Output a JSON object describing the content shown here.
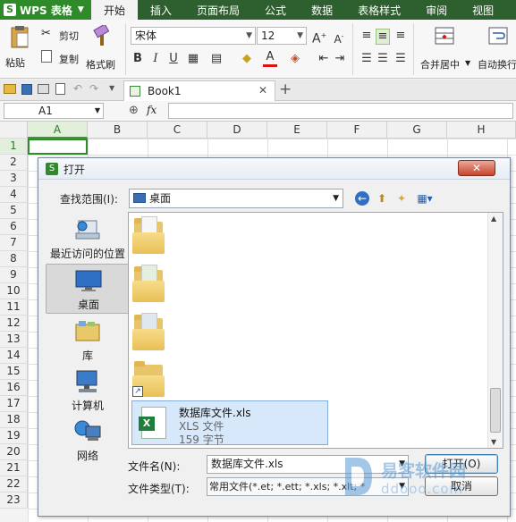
{
  "app": {
    "name": "WPS 表格"
  },
  "menu": [
    "开始",
    "插入",
    "页面布局",
    "公式",
    "数据",
    "表格样式",
    "审阅",
    "视图"
  ],
  "ribbon": {
    "paste": "粘贴",
    "cut": "剪切",
    "copy": "复制",
    "format_painter": "格式刷",
    "font_name": "宋体",
    "font_size": "12",
    "merge_center": "合并居中",
    "wrap_text": "自动换行"
  },
  "doc_tab": {
    "title": "Book1"
  },
  "formula_bar": {
    "cell_ref": "A1",
    "fx": "fx"
  },
  "grid": {
    "columns": [
      "A",
      "B",
      "C",
      "D",
      "E",
      "F",
      "G",
      "H"
    ],
    "rows": [
      "1",
      "2",
      "3",
      "4",
      "5",
      "6",
      "7",
      "8",
      "9",
      "10",
      "11",
      "12",
      "13",
      "14",
      "15",
      "16",
      "17",
      "18",
      "19",
      "20",
      "21",
      "22",
      "23"
    ]
  },
  "dialog": {
    "title": "打开",
    "close_label": "✕",
    "look_in_label": "查找范围(I):",
    "look_in_value": "桌面",
    "places": [
      {
        "label": "最近访问的位置",
        "icon": "recent-places-icon"
      },
      {
        "label": "桌面",
        "icon": "desktop-icon"
      },
      {
        "label": "库",
        "icon": "libraries-icon"
      },
      {
        "label": "计算机",
        "icon": "computer-icon"
      },
      {
        "label": "网络",
        "icon": "network-icon"
      }
    ],
    "file": {
      "name": "数据库文件.xls",
      "type": "XLS 文件",
      "size": "159 字节"
    },
    "filename_label": "文件名(N):",
    "filename_value": "数据库文件.xls",
    "filetype_label": "文件类型(T):",
    "filetype_value": "常用文件(*.et; *.ett; *.xls; *.xlt; *",
    "open_button": "打开(O)",
    "cancel_button": "取消"
  },
  "watermark": {
    "line1": "易客软件园",
    "line2": "ddooo.com"
  }
}
